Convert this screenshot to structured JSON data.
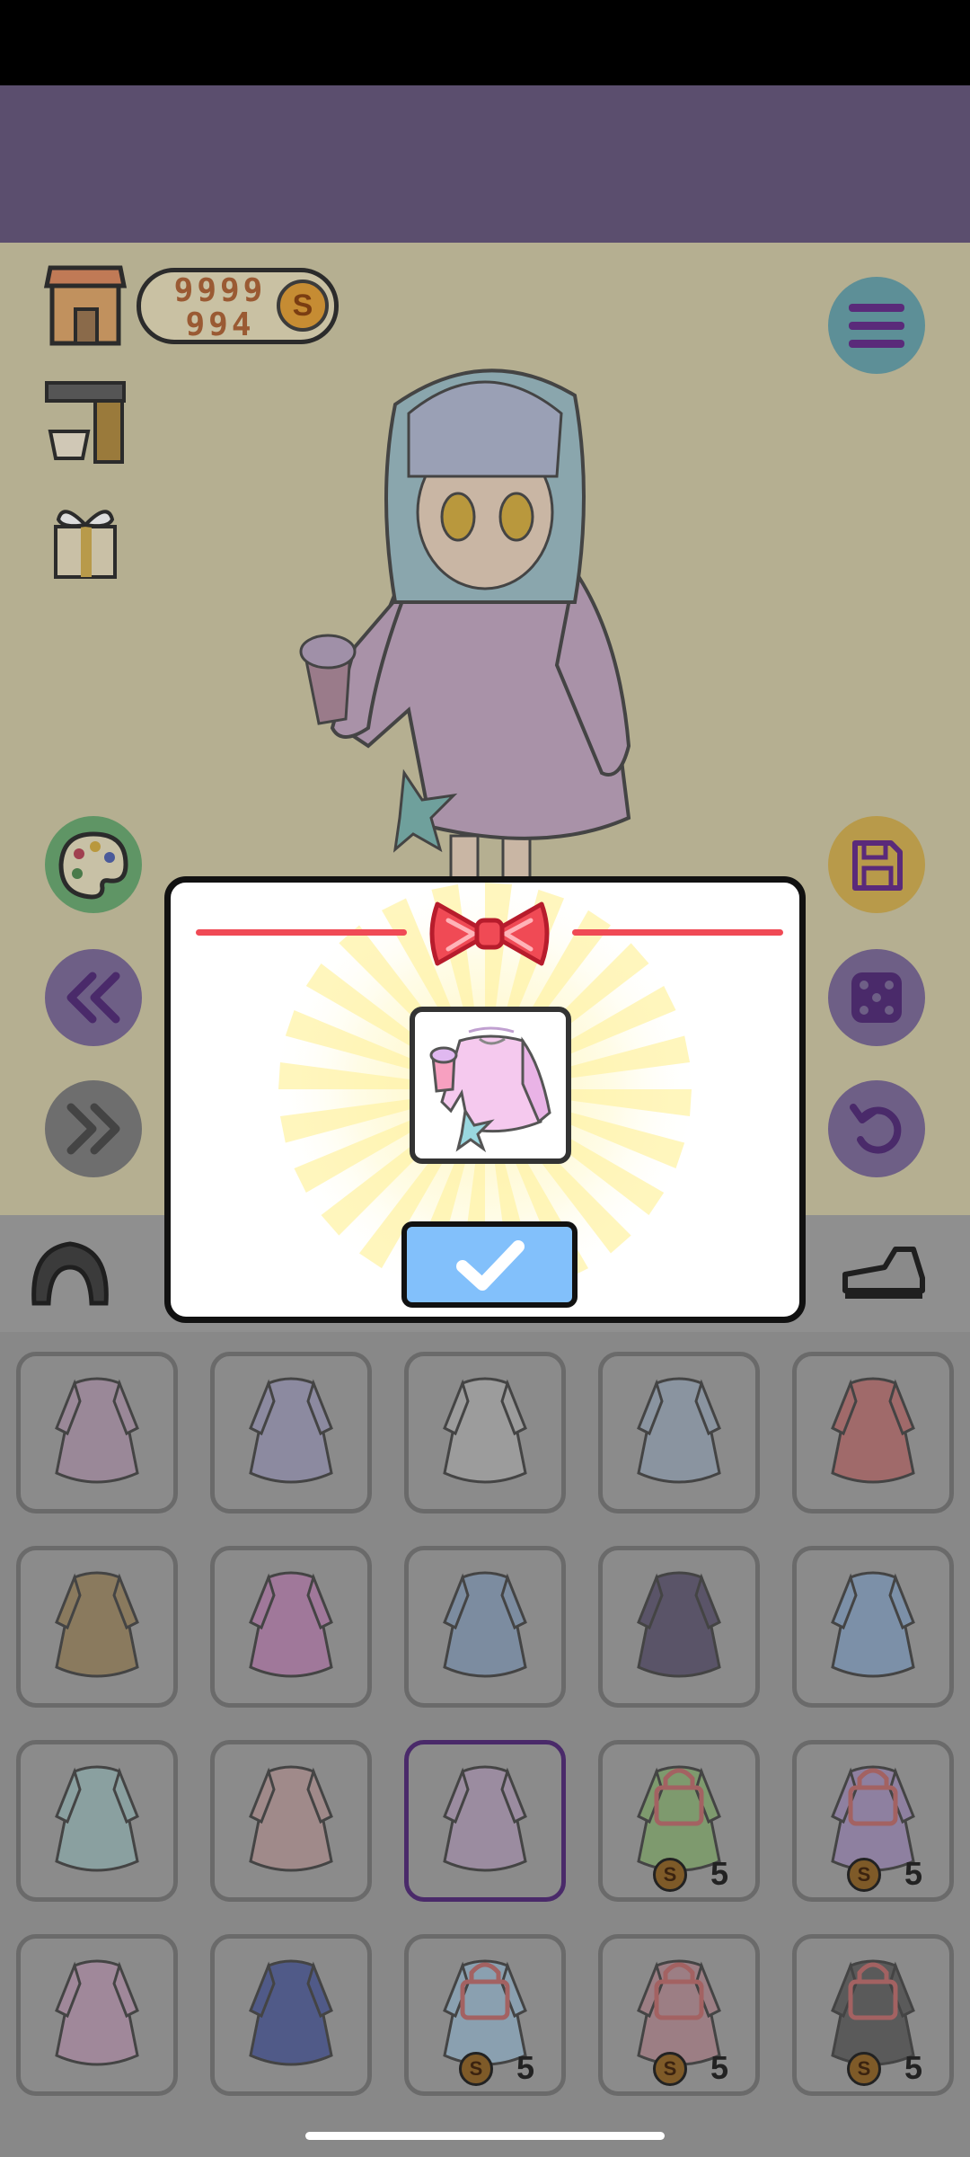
{
  "game": {
    "coins_line1": "9999",
    "coins_line2": "994",
    "coin_symbol": "S"
  },
  "items": [
    {
      "name": "pink-ruffle-dress",
      "locked": false,
      "price": ""
    },
    {
      "name": "lavender-dress",
      "locked": false,
      "price": ""
    },
    {
      "name": "white-lace-dress",
      "locked": false,
      "price": ""
    },
    {
      "name": "blue-mermaid-dress",
      "locked": false,
      "price": ""
    },
    {
      "name": "pink-hoodie",
      "locked": false,
      "price": ""
    },
    {
      "name": "brown-jacket",
      "locked": false,
      "price": ""
    },
    {
      "name": "pink-frill-dress",
      "locked": false,
      "price": ""
    },
    {
      "name": "blue-long-dress",
      "locked": false,
      "price": ""
    },
    {
      "name": "navy-heart-dress",
      "locked": false,
      "price": ""
    },
    {
      "name": "sailor-top",
      "locked": false,
      "price": ""
    },
    {
      "name": "mint-dress",
      "locked": false,
      "price": ""
    },
    {
      "name": "pink-kimono",
      "locked": false,
      "price": ""
    },
    {
      "name": "pink-sweater",
      "locked": false,
      "price": "",
      "selected": true
    },
    {
      "name": "green-top",
      "locked": true,
      "price": "5"
    },
    {
      "name": "purple-dress",
      "locked": true,
      "price": "5"
    },
    {
      "name": "pink-overall",
      "locked": false,
      "price": ""
    },
    {
      "name": "maid-dress",
      "locked": false,
      "price": ""
    },
    {
      "name": "sailor-shirt",
      "locked": true,
      "price": "5"
    },
    {
      "name": "plaid-dress",
      "locked": true,
      "price": "5"
    },
    {
      "name": "grey-sweater",
      "locked": true,
      "price": "5"
    }
  ],
  "colors": {
    "accent_red": "#f04a55",
    "confirm_blue": "#82c0fb",
    "banner_purple": "#5b4e6e"
  },
  "icons": [
    "shop-icon",
    "coffee-machine-icon",
    "gift-icon",
    "menu-icon",
    "palette-icon",
    "save-icon",
    "back-icon",
    "forward-icon",
    "dice-icon",
    "undo-icon",
    "hair-category-icon",
    "shoe-category-icon",
    "ribbon-icon",
    "checkmark-icon"
  ]
}
